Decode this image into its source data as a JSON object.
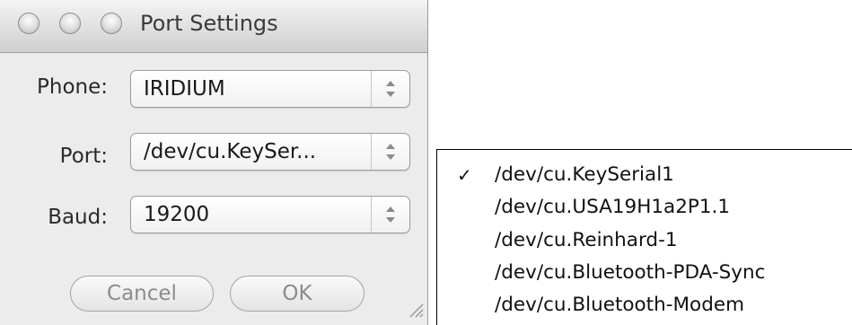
{
  "window": {
    "title": "Port Settings"
  },
  "form": {
    "phone_label": "Phone:",
    "phone_value": "IRIDIUM",
    "port_label": "Port:",
    "port_value": "/dev/cu.KeySer...",
    "baud_label": "Baud:",
    "baud_value": "19200"
  },
  "buttons": {
    "cancel_label": "Cancel",
    "ok_label": "OK"
  },
  "port_menu": {
    "checkmark": "✓",
    "selected_index": 0,
    "items": [
      "/dev/cu.KeySerial1",
      "/dev/cu.USA19H1a2P1.1",
      "/dev/cu.Reinhard-1",
      "/dev/cu.Bluetooth-PDA-Sync",
      "/dev/cu.Bluetooth-Modem"
    ]
  },
  "icons": {
    "window_controls": [
      "close-icon",
      "minimize-icon",
      "zoom-icon"
    ],
    "popup_arrows": "up-down-arrows-icon",
    "resize": "resize-grip-icon"
  }
}
